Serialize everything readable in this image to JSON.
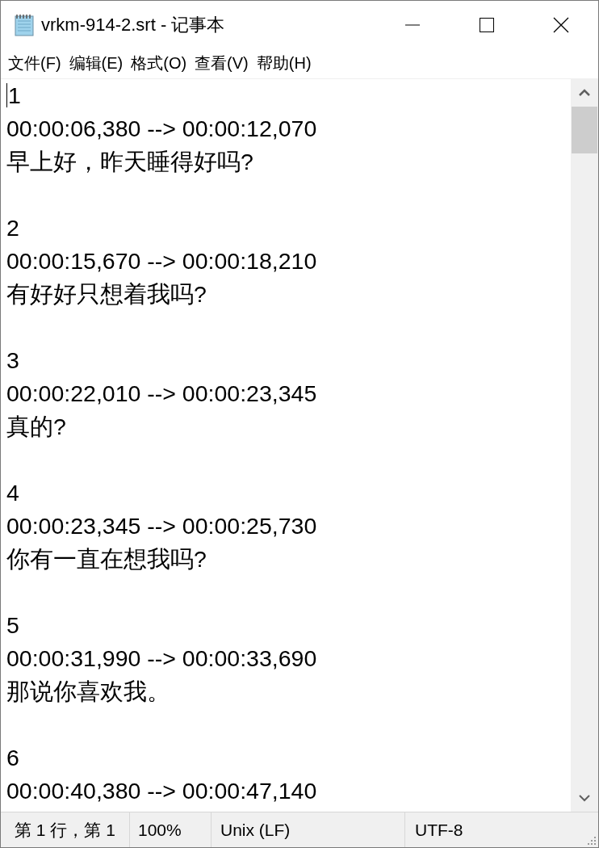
{
  "window": {
    "title": "vrkm-914-2.srt - 记事本"
  },
  "menu": [
    "文件(F)",
    "编辑(E)",
    "格式(O)",
    "查看(V)",
    "帮助(H)"
  ],
  "entries": [
    {
      "index": "1",
      "timing": "00:00:06,380 --> 00:00:12,070",
      "text": "早上好，昨天睡得好吗?"
    },
    {
      "index": "2",
      "timing": "00:00:15,670 --> 00:00:18,210",
      "text": "有好好只想着我吗?"
    },
    {
      "index": "3",
      "timing": "00:00:22,010 --> 00:00:23,345",
      "text": "真的?"
    },
    {
      "index": "4",
      "timing": "00:00:23,345 --> 00:00:25,730",
      "text": "你有一直在想我吗?"
    },
    {
      "index": "5",
      "timing": "00:00:31,990 --> 00:00:33,690",
      "text": "那说你喜欢我。"
    },
    {
      "index": "6",
      "timing": "00:00:40,380 --> 00:00:47,140"
    }
  ],
  "status_bar": {
    "position": "第 1 行，第 1",
    "zoom": "100%",
    "line_endings": "Unix (LF)",
    "encoding": "UTF-8"
  }
}
